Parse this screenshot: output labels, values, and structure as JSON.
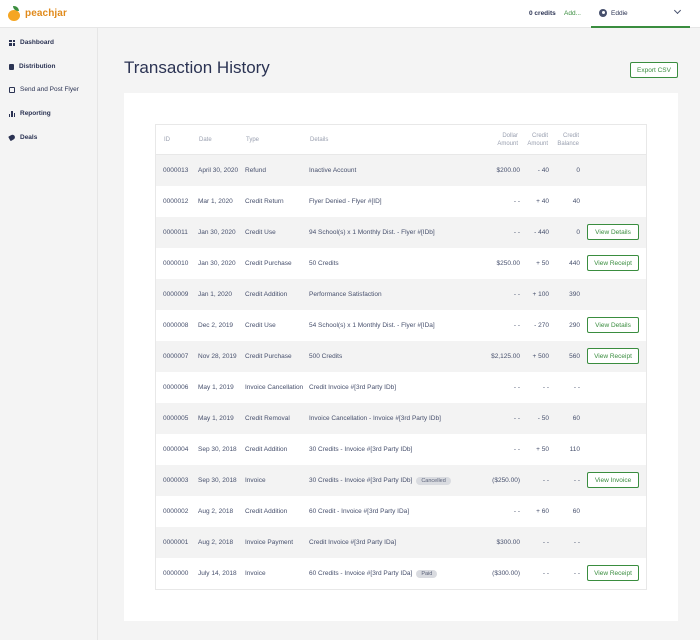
{
  "brand": {
    "name": "peachjar"
  },
  "header": {
    "credits": "0 credits",
    "add_link": "Add...",
    "user_name": "Eddie"
  },
  "sidebar": {
    "items": [
      {
        "label": "Dashboard",
        "icon": "dashboard-icon"
      },
      {
        "label": "Distribution",
        "icon": "document-icon"
      },
      {
        "label": "Send and Post Flyer",
        "icon": "send-icon"
      },
      {
        "label": "Reporting",
        "icon": "bar-chart-icon"
      },
      {
        "label": "Deals",
        "icon": "tag-icon"
      }
    ]
  },
  "page": {
    "title": "Transaction History",
    "export_label": "Export CSV"
  },
  "table": {
    "headers": {
      "id": "ID",
      "date": "Date",
      "type": "Type",
      "details": "Details",
      "dollar_amount": [
        "Dollar",
        "Amount"
      ],
      "credit_amount": [
        "Credit",
        "Amount"
      ],
      "credit_balance": [
        "Credit",
        "Balance"
      ]
    },
    "rows": [
      {
        "id": "0000013",
        "date": "April 30, 2020",
        "type": "Refund",
        "details": "Inactive Account",
        "badge": "",
        "dollar": "$200.00",
        "credit": "- 40",
        "balance": "0",
        "action": ""
      },
      {
        "id": "0000012",
        "date": "Mar 1, 2020",
        "type": "Credit Return",
        "details": "Flyer Denied - Flyer #[ID]",
        "badge": "",
        "dollar": "- -",
        "credit": "+ 40",
        "balance": "40",
        "action": ""
      },
      {
        "id": "0000011",
        "date": "Jan 30, 2020",
        "type": "Credit Use",
        "details": "94 School(s) x 1 Monthly Dist. - Flyer #[IDb]",
        "badge": "",
        "dollar": "- -",
        "credit": "- 440",
        "balance": "0",
        "action": "View Details"
      },
      {
        "id": "0000010",
        "date": "Jan 30, 2020",
        "type": "Credit Purchase",
        "details": "50 Credits",
        "badge": "",
        "dollar": "$250.00",
        "credit": "+ 50",
        "balance": "440",
        "action": "View Receipt"
      },
      {
        "id": "0000009",
        "date": "Jan 1, 2020",
        "type": "Credit Addition",
        "details": "Performance Satisfaction",
        "badge": "",
        "dollar": "- -",
        "credit": "+ 100",
        "balance": "390",
        "action": ""
      },
      {
        "id": "0000008",
        "date": "Dec 2, 2019",
        "type": "Credit Use",
        "details": "54 School(s) x 1 Monthly Dist. - Flyer #[IDa]",
        "badge": "",
        "dollar": "- -",
        "credit": "- 270",
        "balance": "290",
        "action": "View Details"
      },
      {
        "id": "0000007",
        "date": "Nov 28, 2019",
        "type": "Credit Purchase",
        "details": "500 Credits",
        "badge": "",
        "dollar": "$2,125.00",
        "credit": "+ 500",
        "balance": "560",
        "action": "View Receipt"
      },
      {
        "id": "0000006",
        "date": "May 1, 2019",
        "type": "Invoice Cancellation",
        "details": "Credit Invoice #[3rd Party IDb]",
        "badge": "",
        "dollar": "- -",
        "credit": "- -",
        "balance": "- -",
        "action": ""
      },
      {
        "id": "0000005",
        "date": "May 1, 2019",
        "type": "Credit Removal",
        "details": "Invoice Cancellation - Invoice #[3rd Party IDb]",
        "badge": "",
        "dollar": "- -",
        "credit": "- 50",
        "balance": "60",
        "action": ""
      },
      {
        "id": "0000004",
        "date": "Sep 30, 2018",
        "type": "Credit Addition",
        "details": "30 Credits - Invoice #[3rd Party IDb]",
        "badge": "",
        "dollar": "- -",
        "credit": "+ 50",
        "balance": "110",
        "action": ""
      },
      {
        "id": "0000003",
        "date": "Sep 30, 2018",
        "type": "Invoice",
        "details": "30 Credits - Invoice #[3rd Party IDb]",
        "badge": "Cancelled",
        "dollar": "($250.00)",
        "credit": "- -",
        "balance": "- -",
        "action": "View Invoice"
      },
      {
        "id": "0000002",
        "date": "Aug 2, 2018",
        "type": "Credit Addition",
        "details": "60 Credit - Invoice #[3rd Party IDa]",
        "badge": "",
        "dollar": "- -",
        "credit": "+ 60",
        "balance": "60",
        "action": ""
      },
      {
        "id": "0000001",
        "date": "Aug 2, 2018",
        "type": "Invoice Payment",
        "details": "Credit Invoice #[3rd Party IDa]",
        "badge": "",
        "dollar": "$300.00",
        "credit": "- -",
        "balance": "- -",
        "action": ""
      },
      {
        "id": "0000000",
        "date": "July 14, 2018",
        "type": "Invoice",
        "details": "60 Credits - Invoice #[3rd Party IDa]",
        "badge": "Paid",
        "dollar": "($300.00)",
        "credit": "- -",
        "balance": "- -",
        "action": "View Receipt"
      }
    ]
  },
  "colors": {
    "accent": "#3a8d3f",
    "brand": "#e08a1b",
    "text": "#47506d",
    "row_alt": "#f3f3f3"
  }
}
